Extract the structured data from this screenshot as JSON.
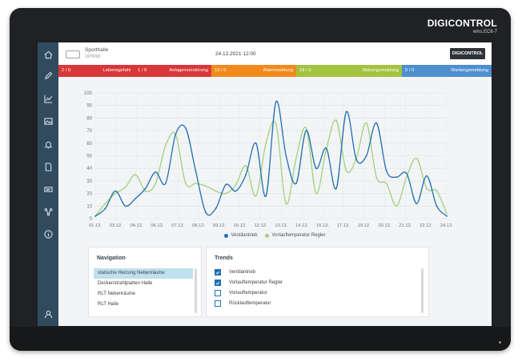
{
  "device": {
    "brand": "DIGICONTROL",
    "model": "ems.EC6-7"
  },
  "header": {
    "site_name": "Sporthalle",
    "site_id": "1970002",
    "datetime": "24.12.2021 12:00",
    "brand_button": "DIGICONTROL"
  },
  "colors": {
    "sidebar": "#324a5d",
    "lebensgefahr": "#d9373a",
    "anlagenstoerung": "#e8711e",
    "alarm": "#f08a1c",
    "stoerung": "#a3c33f",
    "wartung": "#4e8fcf",
    "series1": "#1f6fb2",
    "series2": "#9fd27c"
  },
  "sidebar": {
    "icons": [
      "home-icon",
      "pencil-icon",
      "chart-icon",
      "image-icon",
      "bell-icon",
      "document-icon",
      "device-icon",
      "network-icon",
      "info-icon",
      "user-icon"
    ]
  },
  "status_bar": [
    {
      "count": "2 / 0",
      "label": "Lebensgefahr"
    },
    {
      "count": "1 / 0",
      "label": "Anlagenzerstörung"
    },
    {
      "count": "16 / 0",
      "label": "Alarmmeldung"
    },
    {
      "count": "18 / 0",
      "label": "Störungsmeldung"
    },
    {
      "count": "5 / 0",
      "label": "Wartungsmeldung"
    }
  ],
  "chart_data": {
    "type": "line",
    "x": [
      "01.12.",
      "03.12.",
      "04.12.",
      "06.12.",
      "07.12.",
      "08.12.",
      "09.12.",
      "10.12.",
      "12.12.",
      "13.12.",
      "14.12.",
      "16.12.",
      "17.12.",
      "19.12.",
      "20.12.",
      "21.12.",
      "22.12.",
      "24.12."
    ],
    "ylim": [
      0,
      100
    ],
    "yticks": [
      "0",
      "10",
      "20",
      "30",
      "40",
      "50",
      "60",
      "70",
      "80",
      "90",
      "100"
    ],
    "grid": true,
    "legend": "bottom",
    "series": [
      {
        "name": "Ventilantrieb",
        "color": "#1f6fb2",
        "values": [
          2,
          8,
          22,
          10,
          16,
          24,
          37,
          28,
          67,
          72,
          38,
          5,
          8,
          27,
          22,
          35,
          60,
          18,
          93,
          50,
          28,
          70,
          40,
          56,
          24,
          85,
          47,
          50,
          76,
          38,
          33,
          36,
          12,
          34,
          10,
          2
        ]
      },
      {
        "name": "Vorlauftemperatur Regler",
        "color": "#9fd27c",
        "values": [
          2,
          12,
          20,
          25,
          35,
          22,
          28,
          58,
          67,
          28,
          28,
          26,
          22,
          20,
          27,
          42,
          18,
          60,
          75,
          12,
          48,
          72,
          20,
          55,
          78,
          38,
          48,
          76,
          33,
          28,
          10,
          33,
          48,
          24,
          22,
          4
        ]
      }
    ]
  },
  "navigation": {
    "title": "Navigation",
    "items": [
      "statische Heizung Nebenräume",
      "Deckenstrahlplatten Halle",
      "RLT Nebenräume",
      "RLT Halle"
    ],
    "selected_index": 0
  },
  "trends": {
    "title": "Trends",
    "items": [
      {
        "label": "Ventilantrieb",
        "checked": true
      },
      {
        "label": "Vorlauftemperatur Regler",
        "checked": true
      },
      {
        "label": "Vorlauftemperatur",
        "checked": false
      },
      {
        "label": "Rücklauftemperatur",
        "checked": false
      }
    ]
  }
}
